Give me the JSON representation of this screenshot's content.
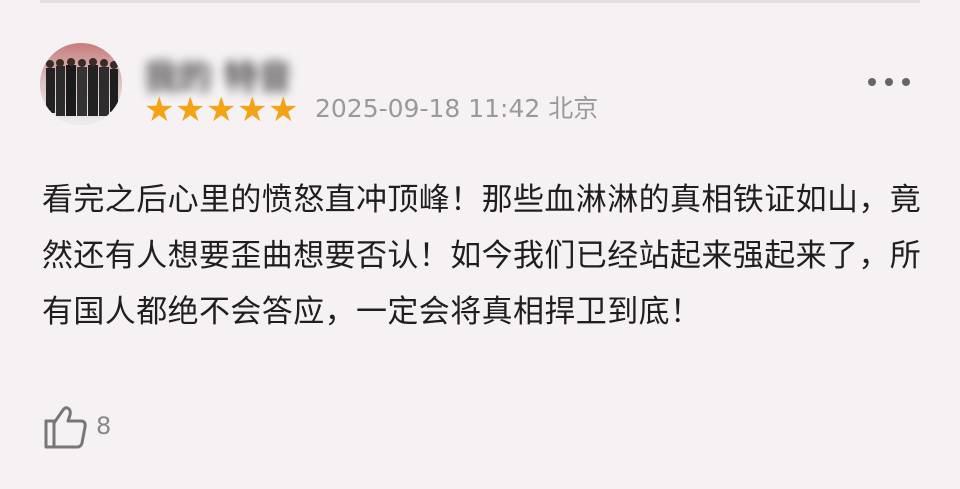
{
  "comment": {
    "username": "我的 特音",
    "rating": 5,
    "timestamp": "2025-09-18 11:42 北京",
    "body": "看完之后心里的愤怒直冲顶峰！那些血淋淋的真相铁证如山，竟然还有人想要歪曲想要否认！如今我们已经站起来强起来了，所有国人都绝不会答应，一定会将真相捍卫到底！",
    "likes": "8"
  },
  "icons": {
    "more": "more-icon",
    "like": "thumbs-up-icon",
    "star": "star-icon"
  },
  "colors": {
    "background": "#f6f2f3",
    "star": "#f5a316",
    "timestamp": "#9a9a9a"
  }
}
